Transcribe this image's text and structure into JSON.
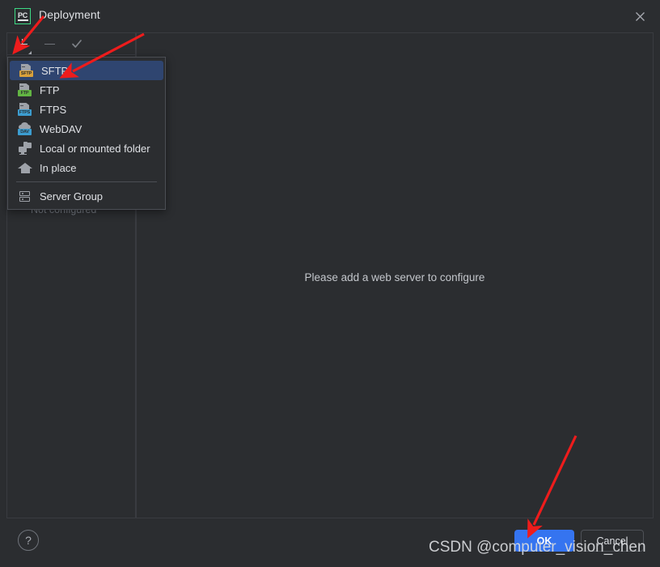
{
  "window": {
    "title": "Deployment",
    "logo_text": "PC",
    "close_icon": "close-icon"
  },
  "toolbar": {
    "add_label": "+",
    "remove_label": "−",
    "apply_label": "✓",
    "add_icon": "plus-icon",
    "remove_icon": "minus-icon",
    "apply_icon": "check-icon"
  },
  "left_panel": {
    "status_text": "Not configured"
  },
  "dropdown": {
    "items": [
      {
        "label": "SFTP",
        "icon": "sftp-icon",
        "badge": "SFTP",
        "selected": true
      },
      {
        "label": "FTP",
        "icon": "ftp-icon",
        "badge": "FTP",
        "selected": false
      },
      {
        "label": "FTPS",
        "icon": "ftps-icon",
        "badge": "FTPS",
        "selected": false
      },
      {
        "label": "WebDAV",
        "icon": "webdav-icon",
        "badge": "DAV",
        "selected": false
      },
      {
        "label": "Local or mounted folder",
        "icon": "local-folder-icon",
        "badge": "",
        "selected": false
      },
      {
        "label": "In place",
        "icon": "home-icon",
        "badge": "",
        "selected": false
      },
      {
        "label": "Server Group",
        "icon": "server-group-icon",
        "badge": "",
        "selected": false
      }
    ]
  },
  "main": {
    "empty_message": "Please add a web server to configure"
  },
  "footer": {
    "help_label": "?",
    "ok_label": "OK",
    "cancel_label": "Cancel"
  },
  "watermark": {
    "text": "CSDN @computer_vision_chen"
  },
  "colors": {
    "background": "#2b2d30",
    "border": "#393b40",
    "accent": "#3574f0",
    "selection": "#2f4570",
    "annotation": "#ee1c1c",
    "badge_sftp": "#d9a13b",
    "badge_ftp": "#62b543",
    "badge_ftps": "#3c9dd0"
  }
}
